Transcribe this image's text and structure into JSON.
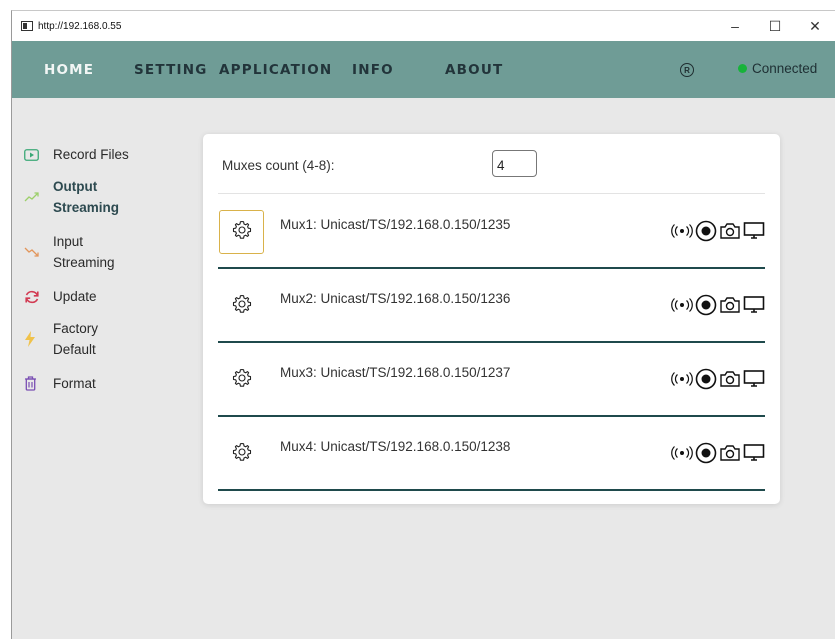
{
  "window": {
    "title": "http://192.168.0.55",
    "controls": {
      "minimize": "–",
      "maximize": "☐",
      "close": "✕"
    }
  },
  "navbar": {
    "items": [
      {
        "label": "HOME",
        "active": true
      },
      {
        "label": "SETTING",
        "active": false
      },
      {
        "label": "APPLICATION",
        "active": false
      },
      {
        "label": "INFO",
        "active": false
      },
      {
        "label": "ABOUT",
        "active": false
      }
    ],
    "logo_text": "R",
    "status": {
      "label": "Connected",
      "color": "#17b33a"
    },
    "background": "#6f9c96"
  },
  "sidebar": {
    "items": [
      {
        "label": "Record Files",
        "icon": "play-square-icon"
      },
      {
        "label": "Output Streaming",
        "icon": "output-trend-icon",
        "active": true
      },
      {
        "label": "Input Streaming",
        "icon": "input-trend-icon"
      },
      {
        "label": "Update",
        "icon": "refresh-icon"
      },
      {
        "label": "Factory Default",
        "icon": "lightning-icon"
      },
      {
        "label": "Format",
        "icon": "trash-icon"
      }
    ]
  },
  "main": {
    "muxes_count_label": "Muxes count (4-8):",
    "muxes_count_value": "4",
    "muxes": [
      {
        "label": "Mux1: Unicast/TS/192.168.0.150/1235",
        "focused": true
      },
      {
        "label": "Mux2: Unicast/TS/192.168.0.150/1236",
        "focused": false
      },
      {
        "label": "Mux3: Unicast/TS/192.168.0.150/1237",
        "focused": false
      },
      {
        "label": "Mux4: Unicast/TS/192.168.0.150/1238",
        "focused": false
      }
    ],
    "row_actions": [
      "broadcast-icon",
      "record-icon",
      "camera-icon",
      "monitor-icon"
    ]
  }
}
